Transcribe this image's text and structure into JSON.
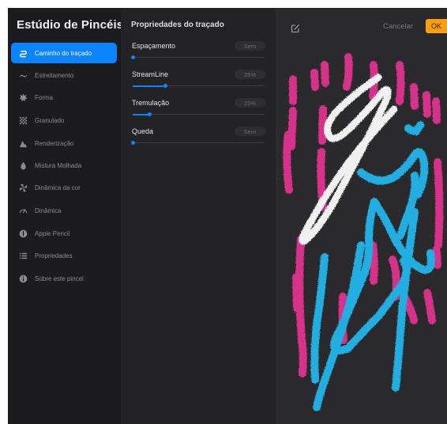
{
  "sidebar": {
    "title": "Estúdio de Pincéis",
    "items": [
      {
        "label": "Caminho do traçado",
        "icon": "stroke-path-icon",
        "active": true
      },
      {
        "label": "Estreitamento",
        "icon": "taper-icon",
        "active": false
      },
      {
        "label": "Forma",
        "icon": "shape-icon",
        "active": false
      },
      {
        "label": "Granulado",
        "icon": "grain-icon",
        "active": false
      },
      {
        "label": "Renderização",
        "icon": "rendering-icon",
        "active": false
      },
      {
        "label": "Mistura Molhada",
        "icon": "wet-mix-icon",
        "active": false
      },
      {
        "label": "Dinâmica da cor",
        "icon": "color-dynamics-icon",
        "active": false
      },
      {
        "label": "Dinâmica",
        "icon": "dynamics-icon",
        "active": false
      },
      {
        "label": "Apple Pencil",
        "icon": "apple-pencil-icon",
        "active": false
      },
      {
        "label": "Propriedades",
        "icon": "properties-icon",
        "active": false
      },
      {
        "label": "Sobre este pincel",
        "icon": "info-icon",
        "active": false
      }
    ]
  },
  "panel": {
    "title": "Propriedades do traçado",
    "properties": [
      {
        "label": "Espaçamento",
        "value": "Sem",
        "level": 0.0
      },
      {
        "label": "StreamLine",
        "value": "25%",
        "level": 0.25
      },
      {
        "label": "Tremulação",
        "value": "25%",
        "level": 0.13
      },
      {
        "label": "Queda",
        "value": "Sem",
        "level": 0.0
      }
    ]
  },
  "preview": {
    "edit_icon": "edit-icon",
    "cancel_label": "Cancelar",
    "ok_label": "OK"
  },
  "colors": {
    "accent": "#0a84ff",
    "ok": "#ff9f0a",
    "stroke_white": "#f2f2f2",
    "stroke_pink": "#d6318a",
    "stroke_blue": "#22aee0"
  }
}
